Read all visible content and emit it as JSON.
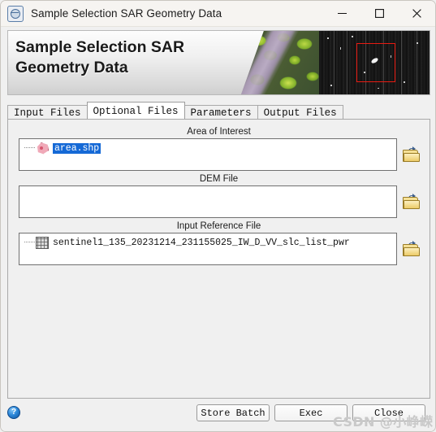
{
  "window": {
    "title": "Sample Selection SAR Geometry Data",
    "app_icon": "sar-globe-icon",
    "controls": {
      "minimize": "minimize-icon",
      "maximize": "maximize-icon",
      "close": "close-icon"
    }
  },
  "banner": {
    "heading": "Sample Selection SAR\nGeometry Data",
    "photo_alt": "aerial-optical-forest-image",
    "sar_alt": "sar-amplitude-image",
    "highlight_box_color": "#e81b12"
  },
  "tabs": [
    {
      "label": "Input Files",
      "active": false
    },
    {
      "label": "Optional Files",
      "active": true
    },
    {
      "label": "Parameters",
      "active": false
    },
    {
      "label": "Output Files",
      "active": false
    }
  ],
  "groups": [
    {
      "label": "Area of Interest",
      "icon": "polygon-shapefile-icon",
      "value": "area.shp",
      "selected": true,
      "browse_icon": "open-folder-icon",
      "empty": false
    },
    {
      "label": "DEM File",
      "icon": "",
      "value": "",
      "selected": false,
      "browse_icon": "open-folder-icon",
      "empty": true
    },
    {
      "label": "Input Reference File",
      "icon": "raster-grid-icon",
      "value": "sentinel1_135_20231214_231155025_IW_D_VV_slc_list_pwr",
      "selected": false,
      "browse_icon": "open-folder-icon",
      "empty": false
    }
  ],
  "footer": {
    "help_icon": "help-question-icon",
    "help_glyph": "?",
    "buttons": [
      {
        "id": "store",
        "label": "Store Batch"
      },
      {
        "id": "exec",
        "label": "Exec"
      },
      {
        "id": "close",
        "label": "Close"
      }
    ]
  },
  "watermark": "CSDN @小峥嵘",
  "colors": {
    "panel_bg": "#f0f0f0",
    "titlebar_bg": "#f6f4f1",
    "field_bg": "#ffffff",
    "selection_blue": "#1569d6",
    "folder_yellow": "#eccb68"
  }
}
